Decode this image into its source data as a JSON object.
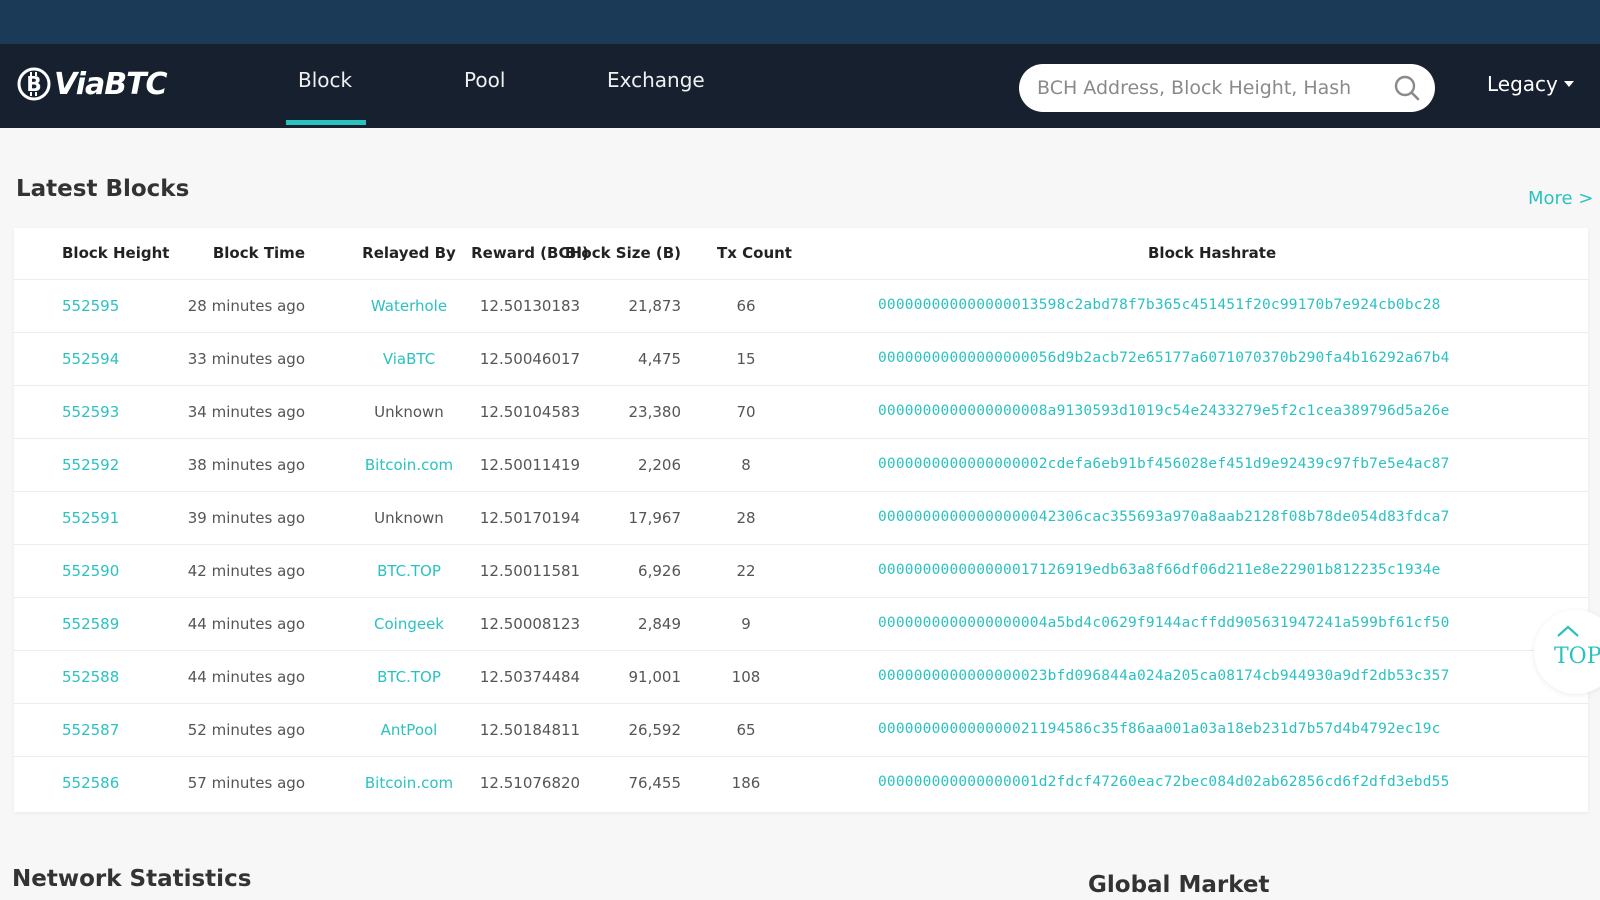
{
  "brand": {
    "name": "ViaBTC"
  },
  "nav": {
    "items": [
      "Block",
      "Pool",
      "Exchange"
    ],
    "active": "Block"
  },
  "search": {
    "placeholder": "BCH Address, Block Height, Hash"
  },
  "legacy_label": "Legacy",
  "latest_blocks": {
    "title": "Latest Blocks",
    "more_label": "More >",
    "columns": [
      "Block Height",
      "Block Time",
      "Relayed By",
      "Reward (BCH)",
      "Block Size (B)",
      "Tx Count",
      "Block Hashrate"
    ],
    "rows": [
      {
        "height": "552595",
        "time": "28 minutes ago",
        "relayed": "Waterhole",
        "relayed_link": true,
        "reward": "12.50130183",
        "size": "21,873",
        "tx": "66",
        "hash": "000000000000000013598c2abd78f7b365c451451f20c99170b7e924cb0bc28"
      },
      {
        "height": "552594",
        "time": "33 minutes ago",
        "relayed": "ViaBTC",
        "relayed_link": true,
        "reward": "12.50046017",
        "size": "4,475",
        "tx": "15",
        "hash": "00000000000000000056d9b2acb72e65177a6071070370b290fa4b16292a67b4"
      },
      {
        "height": "552593",
        "time": "34 minutes ago",
        "relayed": "Unknown",
        "relayed_link": false,
        "reward": "12.50104583",
        "size": "23,380",
        "tx": "70",
        "hash": "0000000000000000008a9130593d1019c54e2433279e5f2c1cea389796d5a26e"
      },
      {
        "height": "552592",
        "time": "38 minutes ago",
        "relayed": "Bitcoin.com",
        "relayed_link": true,
        "reward": "12.50011419",
        "size": "2,206",
        "tx": "8",
        "hash": "0000000000000000002cdefa6eb91bf456028ef451d9e92439c97fb7e5e4ac87"
      },
      {
        "height": "552591",
        "time": "39 minutes ago",
        "relayed": "Unknown",
        "relayed_link": false,
        "reward": "12.50170194",
        "size": "17,967",
        "tx": "28",
        "hash": "00000000000000000042306cac355693a970a8aab2128f08b78de054d83fdca7"
      },
      {
        "height": "552590",
        "time": "42 minutes ago",
        "relayed": "BTC.TOP",
        "relayed_link": true,
        "reward": "12.50011581",
        "size": "6,926",
        "tx": "22",
        "hash": "000000000000000017126919edb63a8f66df06d211e8e22901b812235c1934e"
      },
      {
        "height": "552589",
        "time": "44 minutes ago",
        "relayed": "Coingeek",
        "relayed_link": true,
        "reward": "12.50008123",
        "size": "2,849",
        "tx": "9",
        "hash": "0000000000000000004a5bd4c0629f9144acffdd905631947241a599bf61cf50"
      },
      {
        "height": "552588",
        "time": "44 minutes ago",
        "relayed": "BTC.TOP",
        "relayed_link": true,
        "reward": "12.50374484",
        "size": "91,001",
        "tx": "108",
        "hash": "0000000000000000023bfd096844a024a205ca08174cb944930a9df2db53c357"
      },
      {
        "height": "552587",
        "time": "52 minutes ago",
        "relayed": "AntPool",
        "relayed_link": true,
        "reward": "12.50184811",
        "size": "26,592",
        "tx": "65",
        "hash": "000000000000000021194586c35f86aa001a03a18eb231d7b57d4b4792ec19c"
      },
      {
        "height": "552586",
        "time": "57 minutes ago",
        "relayed": "Bitcoin.com",
        "relayed_link": true,
        "reward": "12.51076820",
        "size": "76,455",
        "tx": "186",
        "hash": "000000000000000001d2fdcf47260eac72bec084d02ab62856cd6f2dfd3ebd55"
      }
    ]
  },
  "top_button": {
    "label": "TOP"
  },
  "network_statistics": {
    "title": "Network Statistics"
  },
  "global_market": {
    "title": "Global Market"
  },
  "icons": {
    "logo": "bitcoin-logo-icon",
    "search": "search-icon",
    "caret": "caret-down-icon",
    "top": "chevron-up-icon"
  },
  "colors": {
    "accent": "#2cc1c1",
    "navbar": "#17202e",
    "top_strip": "#1b3a57"
  }
}
